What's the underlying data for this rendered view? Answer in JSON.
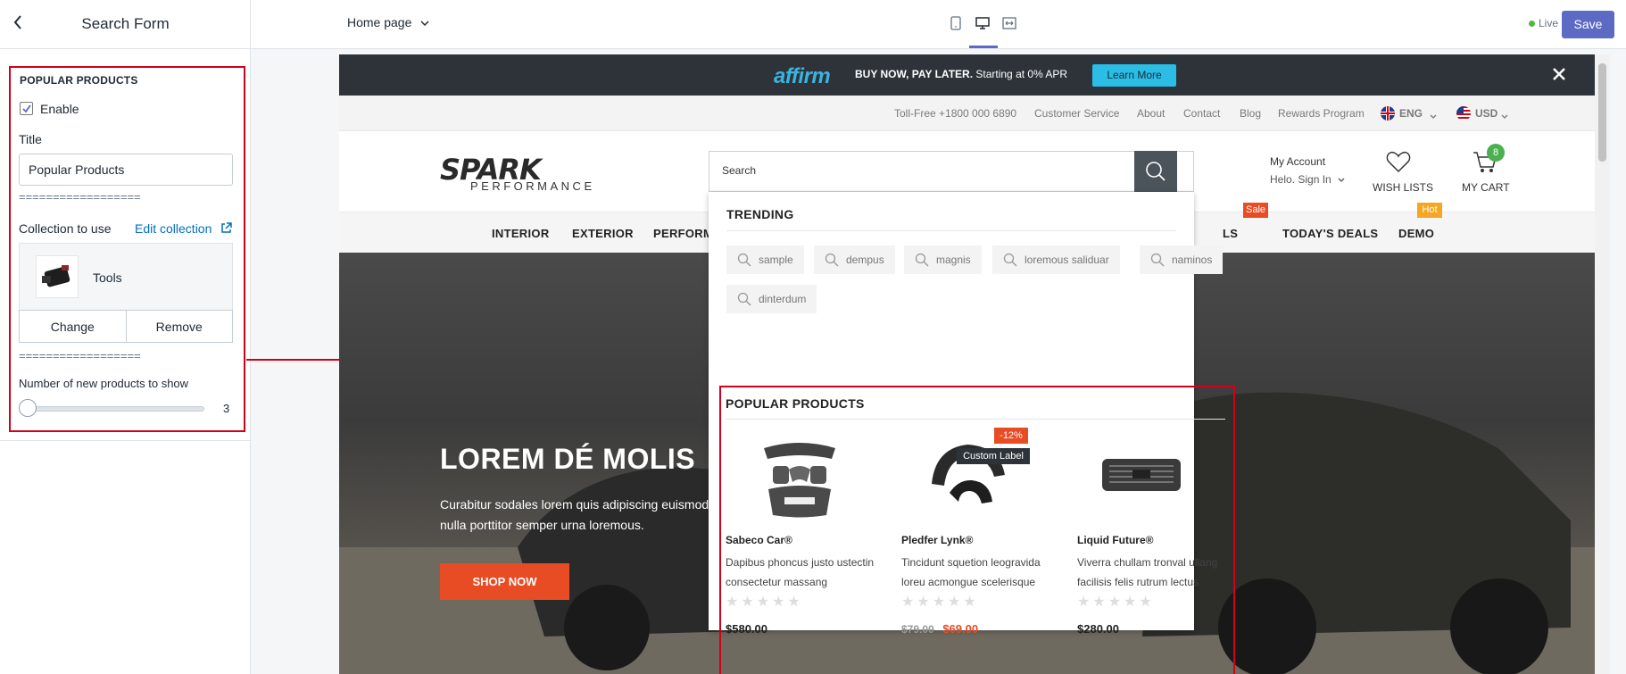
{
  "sidebar": {
    "title": "Search Form",
    "section_heading": "POPULAR PRODUCTS",
    "enable_label": "Enable",
    "enable_checked": true,
    "title_label": "Title",
    "title_value": "Popular Products",
    "separator": "==================",
    "collection_label": "Collection to use",
    "edit_collection": "Edit collection",
    "collection_name": "Tools",
    "change_label": "Change",
    "remove_label": "Remove",
    "count_label": "Number of new products to show",
    "count_value": "3"
  },
  "topbar": {
    "page_select": "Home page",
    "live_label": "Live",
    "save_label": "Save"
  },
  "preview": {
    "announce": {
      "brand": "affirm",
      "text_bold": "BUY NOW, PAY LATER.",
      "text": "Starting at 0% APR",
      "learn_more": "Learn More"
    },
    "util_links": [
      "Toll-Free +1800 000 6890",
      "Customer Service",
      "About",
      "Contact",
      "Blog",
      "Rewards Program",
      "ENG",
      "USD"
    ],
    "logo": "SPARK",
    "logo_sub": "PERFORMANCE",
    "search_placeholder": "Search",
    "account": {
      "title": "My Account",
      "sub": "Helo. Sign In"
    },
    "wishlist": "WISH LISTS",
    "cart": {
      "label": "MY CART",
      "count": "8"
    },
    "nav": [
      "INTERIOR",
      "EXTERIOR",
      "PERFORM",
      "LS",
      "TODAY'S DEALS",
      "DEMO"
    ],
    "nav_badges": {
      "sale": "Sale",
      "hot": "Hot"
    },
    "hero": {
      "title": "LOREM DÉ MOLIS",
      "subtitle": "Curabitur sodales lorem quis adipiscing euismod nulla porttitor semper urna loremous.",
      "cta": "SHOP NOW"
    },
    "dropdown": {
      "trending_title": "TRENDING",
      "trending": [
        "sample",
        "dempus",
        "magnis",
        "loremous saliduar",
        "naminos",
        "dinterdum"
      ],
      "popular_title": "POPULAR PRODUCTS",
      "products": [
        {
          "name": "Sabeco Car®",
          "desc": "Dapibus phoncus justo ustectin consectetur massang",
          "price": "$580.00",
          "rating": 0
        },
        {
          "name": "Pledfer Lynk®",
          "desc": "Tincidunt squetion leogravida loreu acmongue scelerisque",
          "old_price": "$79.00",
          "price": "$69.00",
          "discount": "-12%",
          "label": "Custom Label",
          "rating": 0
        },
        {
          "name": "Liquid Future®",
          "desc": "Viverra chullam tronval ullang facilisis felis rutrum lectus",
          "price": "$280.00",
          "rating": 0
        }
      ]
    }
  }
}
